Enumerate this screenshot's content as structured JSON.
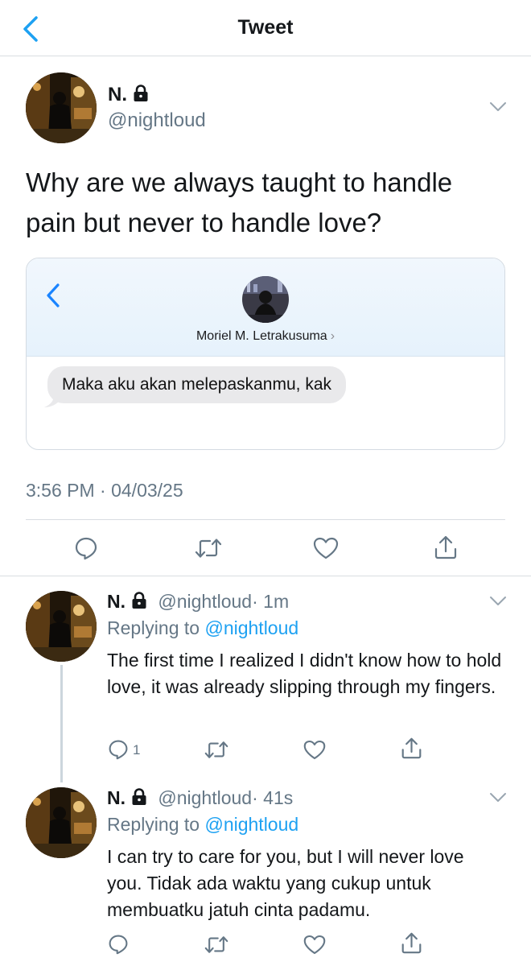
{
  "header": {
    "title": "Tweet",
    "back_icon": "chevron-left-icon"
  },
  "main_tweet": {
    "name": "N.",
    "handle": "@nightloud",
    "text": "Why are we always taught to handle pain but never to handle love?",
    "timestamp": "3:56 PM · 04/03/25",
    "card": {
      "contact_name": "Moriel M. Letrakusuma",
      "contact_chevron": "›",
      "message": "Maka aku akan melepaskanmu, kak"
    }
  },
  "replies": [
    {
      "name": "N.",
      "handle": "@nightloud",
      "time": "· 1m",
      "replying_prefix": "Replying to",
      "replying_handle": "@nightloud",
      "text": "The first time I realized I didn't know how to hold love, it was already slipping through my fingers.",
      "reply_count": "1"
    },
    {
      "name": "N.",
      "handle": "@nightloud",
      "time": "· 41s",
      "replying_prefix": "Replying to",
      "replying_handle": "@nightloud",
      "text": "I can try to care for you, but I will never love you. Tidak ada waktu yang cukup untuk membuatku jatuh cinta padamu.",
      "reply_count": ""
    }
  ],
  "colors": {
    "accent": "#1da1f2",
    "text": "#14171a",
    "secondary": "#657786",
    "divider": "#d9dde1",
    "bubble": "#e9e9eb"
  },
  "icons": [
    "lock-icon",
    "chevron-down-icon",
    "reply-icon",
    "retweet-icon",
    "like-icon",
    "share-icon"
  ]
}
